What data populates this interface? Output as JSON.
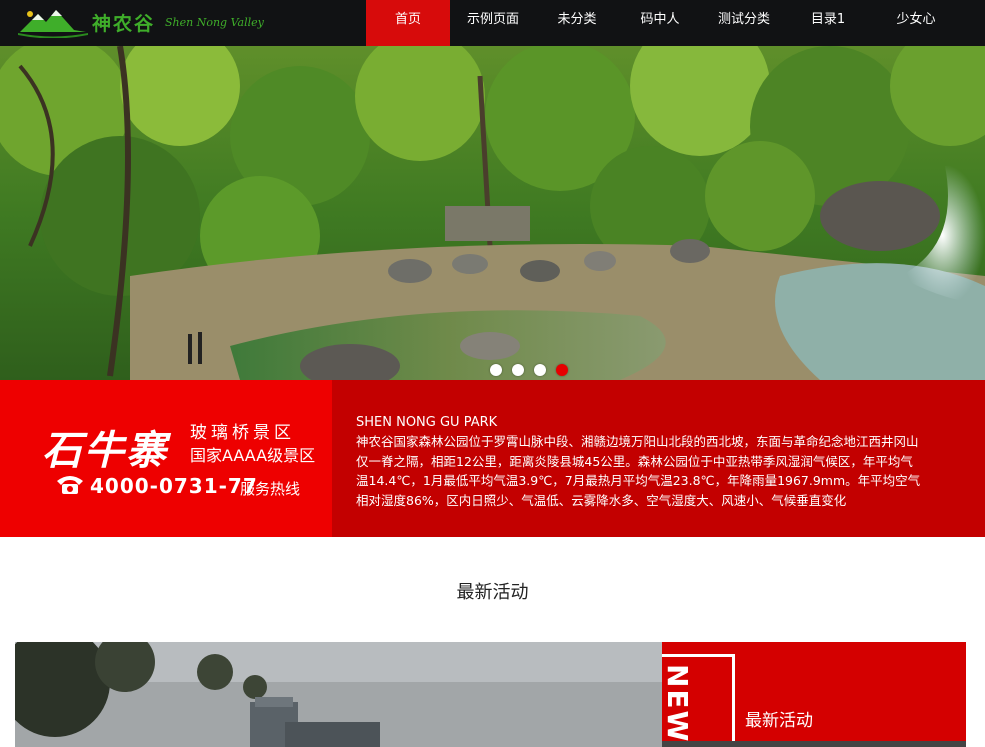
{
  "header": {
    "logo_cn": "神农谷",
    "logo_en": "Shen Nong Valley",
    "nav": [
      "首页",
      "示例页面",
      "未分类",
      "码中人",
      "测试分类",
      "目录1",
      "少女心"
    ],
    "active_index": 0
  },
  "banner": {
    "slide_count": 4,
    "active_slide": 3
  },
  "band": {
    "brand_script": "石牛寨",
    "brand_line1": "玻璃桥景区",
    "brand_line2": "国家AAAA级景区",
    "phone": "4000-0731-77",
    "phone_label": "服务热线",
    "park_title": "SHEN NONG GU PARK",
    "park_desc": "神农谷国家森林公园位于罗霄山脉中段、湘赣边境万阳山北段的西北坡，东面与革命纪念地江西井冈山仅一脊之隔，相距12公里，距离炎陵县城45公里。森林公园位于中亚热带季风湿润气候区，年平均气温14.4℃，1月最低平均气温3.9℃，7月最热月平均气温23.8℃，年降雨量1967.9mm。年平均空气相对湿度86%，区内日照少、气温低、云雾降水多、空气湿度大、风速小、气候垂直变化"
  },
  "section": {
    "title": "最新活动"
  },
  "news": {
    "vertical_label": "NEW",
    "title": "最新活动"
  },
  "colors": {
    "header_bg": "#111214",
    "accent_red": "#d70b0b",
    "band_red": "#c30000",
    "band_bright_red": "#ee0000",
    "logo_green": "#3fae2a"
  }
}
